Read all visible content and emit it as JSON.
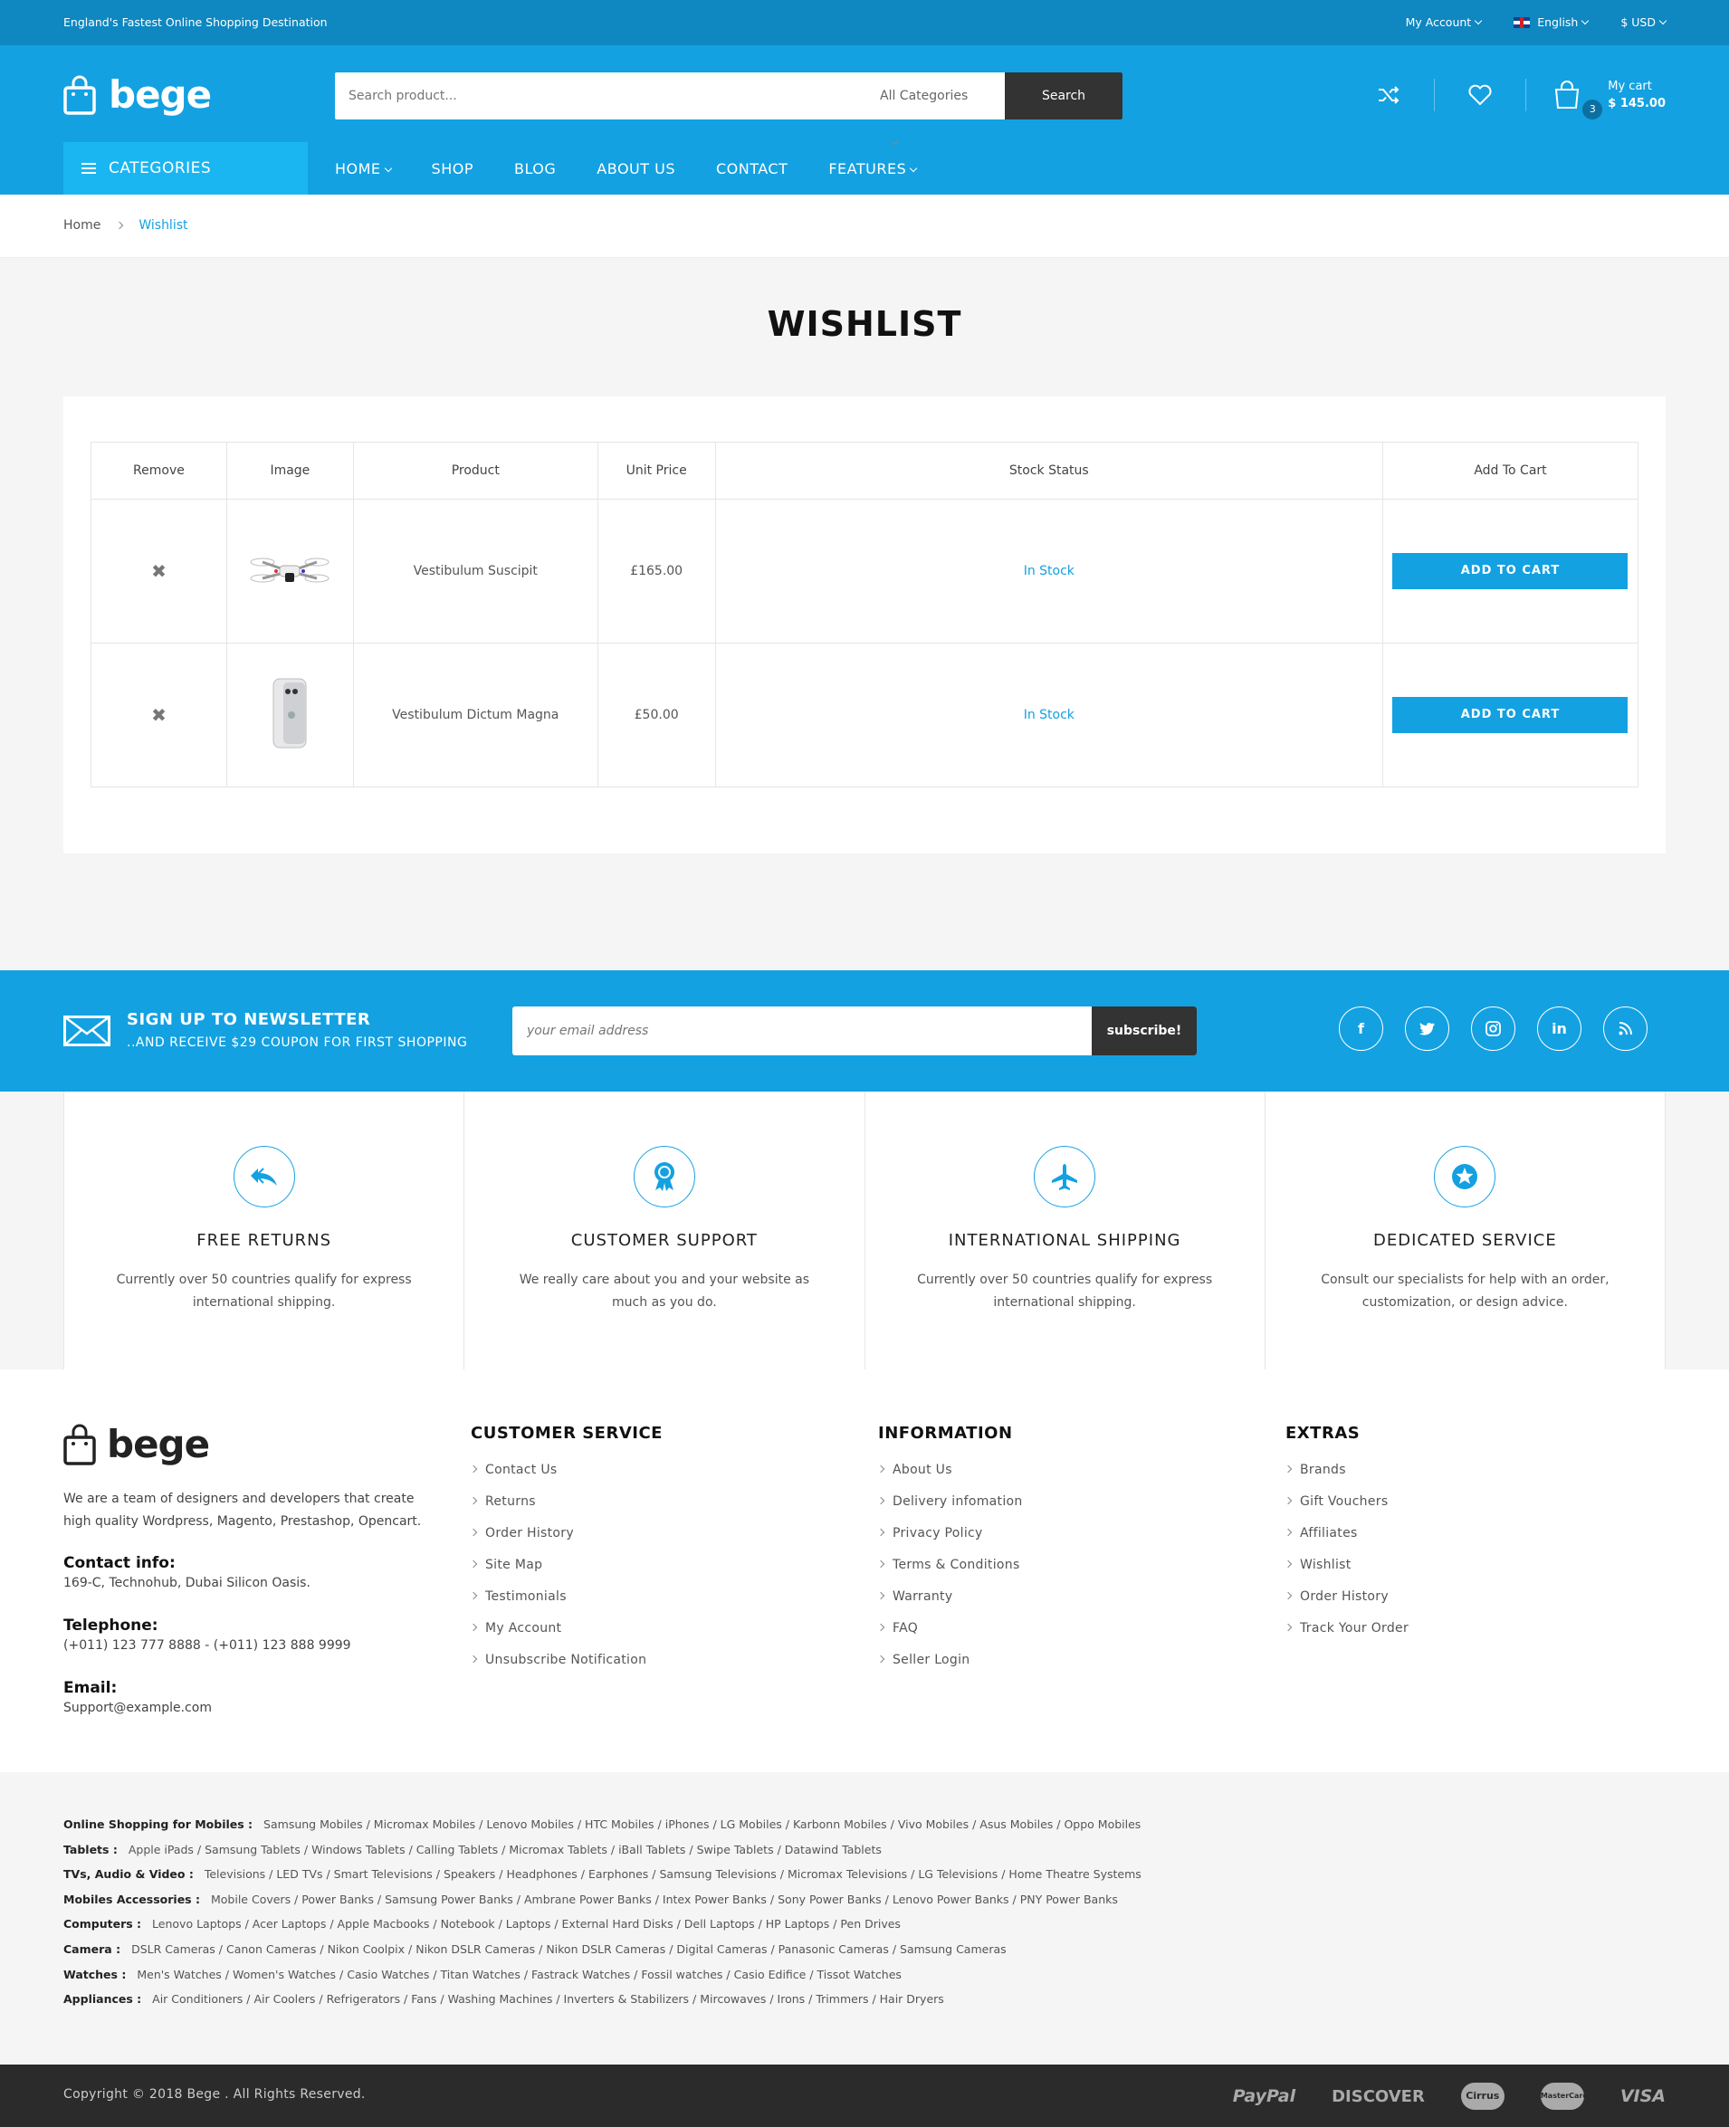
{
  "topbar": {
    "tagline": "England's Fastest Online Shopping Destination",
    "account": "My Account",
    "language": "English",
    "currency": "$ USD"
  },
  "header": {
    "logo": "bege",
    "search_placeholder": "Search product...",
    "search_category": "All Categories",
    "search_button": "Search",
    "cart_count": "3",
    "cart_label": "My cart",
    "cart_total": "$ 145.00"
  },
  "nav": {
    "categories": "CATEGORIES",
    "items": [
      "HOME",
      "SHOP",
      "BLOG",
      "ABOUT US",
      "CONTACT",
      "FEATURES"
    ]
  },
  "breadcrumb": {
    "home": "Home",
    "current": "Wishlist"
  },
  "page_title": "WISHLIST",
  "wishlist": {
    "headers": [
      "Remove",
      "Image",
      "Product",
      "Unit Price",
      "Stock Status",
      "Add To Cart"
    ],
    "rows": [
      {
        "product": "Vestibulum Suscipit",
        "price": "£165.00",
        "stock": "In Stock",
        "button": "ADD TO CART",
        "image": "drone-image"
      },
      {
        "product": "Vestibulum Dictum Magna",
        "price": "£50.00",
        "stock": "In Stock",
        "button": "ADD TO CART",
        "image": "phone-image"
      }
    ]
  },
  "newsletter": {
    "title": "SIGN UP TO NEWSLETTER",
    "subtitle": "..AND RECEIVE $29 COUPON FOR FIRST SHOPPING",
    "placeholder": "your email address",
    "button": "subscribe!",
    "social": [
      "facebook-icon",
      "twitter-icon",
      "instagram-icon",
      "linkedin-icon",
      "rss-icon"
    ]
  },
  "services": [
    {
      "icon": "returns-icon",
      "title": "FREE RETURNS",
      "text": "Currently over 50 countries qualify for express international shipping."
    },
    {
      "icon": "award-icon",
      "title": "CUSTOMER SUPPORT",
      "text": "We really care about you and your website as much as you do."
    },
    {
      "icon": "plane-icon",
      "title": "INTERNATIONAL SHIPPING",
      "text": "Currently over 50 countries qualify for express international shipping."
    },
    {
      "icon": "star-icon",
      "title": "DEDICATED SERVICE",
      "text": "Consult our specialists for help with an order, customization, or design advice."
    }
  ],
  "footer": {
    "logo": "bege",
    "about": "We are a team of designers and developers that create high quality Wordpress, Magento, Prestashop, Opencart.",
    "contact_label": "Contact info:",
    "contact": "169-C, Technohub, Dubai Silicon Oasis.",
    "phone_label": "Telephone:",
    "phone": "(+011) 123 777 8888 - (+011) 123 888 9999",
    "email_label": "Email:",
    "email": "Support@example.com",
    "columns": [
      {
        "title": "CUSTOMER SERVICE",
        "links": [
          "Contact Us",
          "Returns",
          "Order History",
          "Site Map",
          "Testimonials",
          "My Account",
          "Unsubscribe Notification"
        ]
      },
      {
        "title": "INFORMATION",
        "links": [
          "About Us",
          "Delivery infomation",
          "Privacy Policy",
          "Terms & Conditions",
          "Warranty",
          "FAQ",
          "Seller Login"
        ]
      },
      {
        "title": "EXTRAS",
        "links": [
          "Brands",
          "Gift Vouchers",
          "Affiliates",
          "Wishlist",
          "Order History",
          "Track Your Order"
        ]
      }
    ]
  },
  "tags": [
    {
      "label": "Online Shopping for Mobiles :",
      "items": [
        "Samsung Mobiles",
        "Micromax Mobiles",
        "Lenovo Mobiles",
        "HTC Mobiles",
        "iPhones",
        "LG Mobiles",
        "Karbonn Mobiles",
        "Vivo Mobiles",
        "Asus Mobiles",
        "Oppo Mobiles"
      ]
    },
    {
      "label": "Tablets :",
      "items": [
        "Apple iPads",
        "Samsung Tablets",
        "Windows Tablets",
        "Calling Tablets",
        "Micromax Tablets",
        "iBall Tablets",
        "Swipe Tablets",
        "Datawind Tablets"
      ]
    },
    {
      "label": "TVs, Audio & Video :",
      "items": [
        "Televisions",
        "LED TVs",
        "Smart Televisions",
        "Speakers",
        "Headphones",
        "Earphones",
        "Samsung Televisions",
        "Micromax Televisions",
        "LG Televisions",
        "Home Theatre Systems"
      ]
    },
    {
      "label": "Mobiles Accessories :",
      "items": [
        "Mobile Covers",
        "Power Banks",
        "Samsung Power Banks",
        "Ambrane Power Banks",
        "Intex Power Banks",
        "Sony Power Banks",
        "Lenovo Power Banks",
        "PNY Power Banks"
      ]
    },
    {
      "label": "Computers :",
      "items": [
        "Lenovo Laptops",
        "Acer Laptops",
        "Apple Macbooks",
        "Notebook",
        "Laptops",
        "External Hard Disks",
        "Dell Laptops",
        "HP Laptops",
        "Pen Drives"
      ]
    },
    {
      "label": "Camera :",
      "items": [
        "DSLR Cameras",
        "Canon Cameras",
        "Nikon Coolpix",
        "Nikon DSLR Cameras",
        "Nikon DSLR Cameras",
        "Digital Cameras",
        "Panasonic Cameras",
        "Samsung Cameras"
      ]
    },
    {
      "label": "Watches :",
      "items": [
        "Men's Watches",
        "Women's Watches",
        "Casio Watches",
        "Titan Watches",
        "Fastrack Watches",
        "Fossil watches",
        "Casio Edifice",
        "Tissot Watches"
      ]
    },
    {
      "label": "Appliances :",
      "items": [
        "Air Conditioners",
        "Air Coolers",
        "Refrigerators",
        "Fans",
        "Washing Machines",
        "Inverters & Stabilizers",
        "Mircowaves",
        "Irons",
        "Trimmers",
        "Hair Dryers"
      ]
    }
  ],
  "copyright": "Copyright © 2018 Bege . All Rights Reserved.",
  "payments": [
    "PayPal",
    "DISCOVER",
    "Cirrus",
    "MasterCard",
    "VISA"
  ],
  "colors": {
    "primary": "#13a1e2",
    "topbar": "#0f87c0",
    "dark": "#333333"
  }
}
